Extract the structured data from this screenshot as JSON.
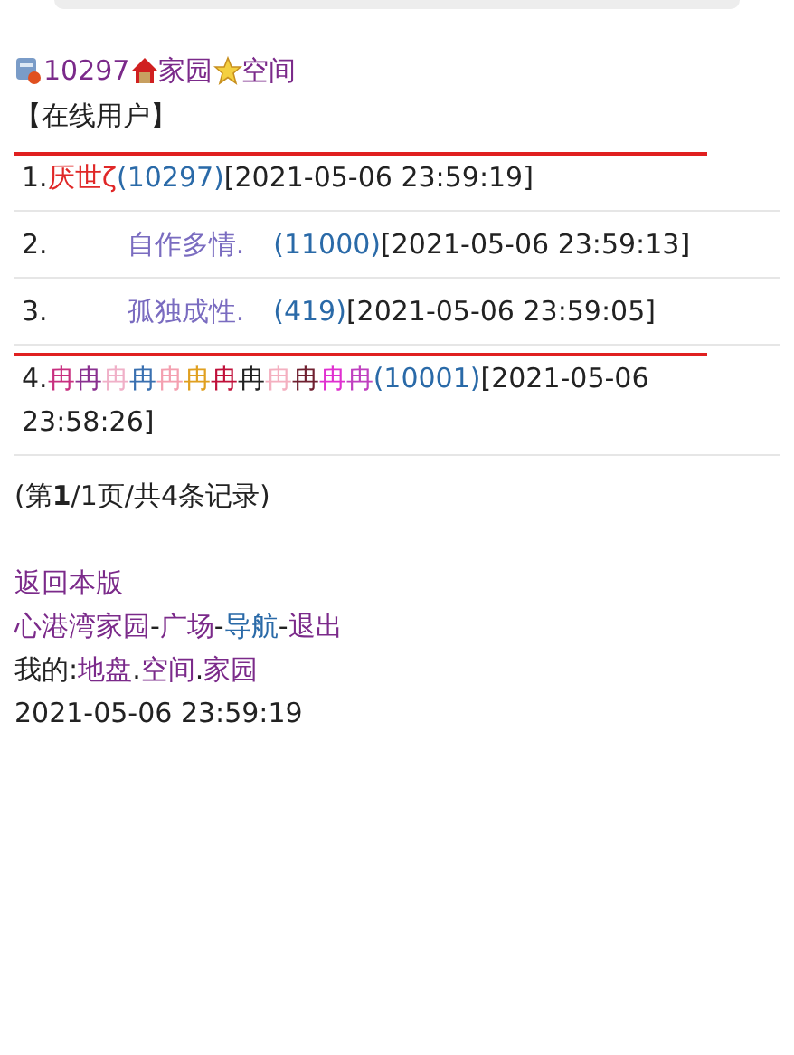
{
  "header": {
    "user_id": "10297",
    "home": "家园",
    "space": "空间"
  },
  "section_title": "【在线用户】",
  "users": [
    {
      "number": "1.",
      "kind": "plain",
      "struck": true,
      "name": [
        {
          "text": "厌世ζ",
          "color": "#e02828"
        }
      ],
      "id": "(10297)",
      "date": "[2021-05-06",
      "clock": "23:59:19]"
    },
    {
      "number": "2.",
      "kind": "indented",
      "struck": false,
      "name": [
        {
          "text": "自作多情.",
          "color": "#7a6cc0"
        }
      ],
      "id": "(11000)",
      "date": "[2021-05-06",
      "clock": "23:59:13]"
    },
    {
      "number": "3.",
      "kind": "indented",
      "struck": false,
      "name": [
        {
          "text": "孤独成性.",
          "color": "#7a6cc0"
        }
      ],
      "id": "(419)",
      "date": "[2021-05-06",
      "clock": "23:59:05]"
    },
    {
      "number": "4.",
      "kind": "plain",
      "struck": true,
      "name": [
        {
          "text": "冉",
          "color": "#c83080"
        },
        {
          "text": "冉",
          "color": "#8a3090"
        },
        {
          "text": "冉",
          "color": "#f0b0c8"
        },
        {
          "text": "冉",
          "color": "#3a70b0"
        },
        {
          "text": "冉",
          "color": "#f4a0b0"
        },
        {
          "text": "冉",
          "color": "#e0a020"
        },
        {
          "text": "冉",
          "color": "#c0103a"
        },
        {
          "text": "冉",
          "color": "#222222"
        },
        {
          "text": "冉",
          "color": "#f4b0c0"
        },
        {
          "text": "冉",
          "color": "#702030"
        },
        {
          "text": "冉",
          "color": "#e030d0"
        },
        {
          "text": "冉",
          "color": "#c040c0"
        }
      ],
      "id": "(10001)",
      "date": "[2021-05-06",
      "clock": "23:58:26]"
    }
  ],
  "pagination": "(第**1**/1页/共4条记录)",
  "back_link": "返回本版",
  "nav": [
    {
      "kind": "link",
      "text": "心港湾家园",
      "color": "#7b2a8a"
    },
    {
      "kind": "text",
      "text": "-"
    },
    {
      "kind": "link",
      "text": "广场",
      "color": "#7b2a8a"
    },
    {
      "kind": "text",
      "text": "-"
    },
    {
      "kind": "link",
      "text": "导航",
      "color": "#2a6aa8"
    },
    {
      "kind": "text",
      "text": "-"
    },
    {
      "kind": "link",
      "text": "退出",
      "color": "#7b2a8a"
    }
  ],
  "mine": {
    "label": "我的:",
    "links": [
      {
        "text": "地盘",
        "color": "#7b2a8a",
        "separator": "."
      },
      {
        "text": "空间",
        "color": "#7b2a8a",
        "separator": "."
      },
      {
        "text": "家园",
        "color": "#7b2a8a"
      }
    ]
  },
  "clock": "2021-05-06 23:59:19"
}
